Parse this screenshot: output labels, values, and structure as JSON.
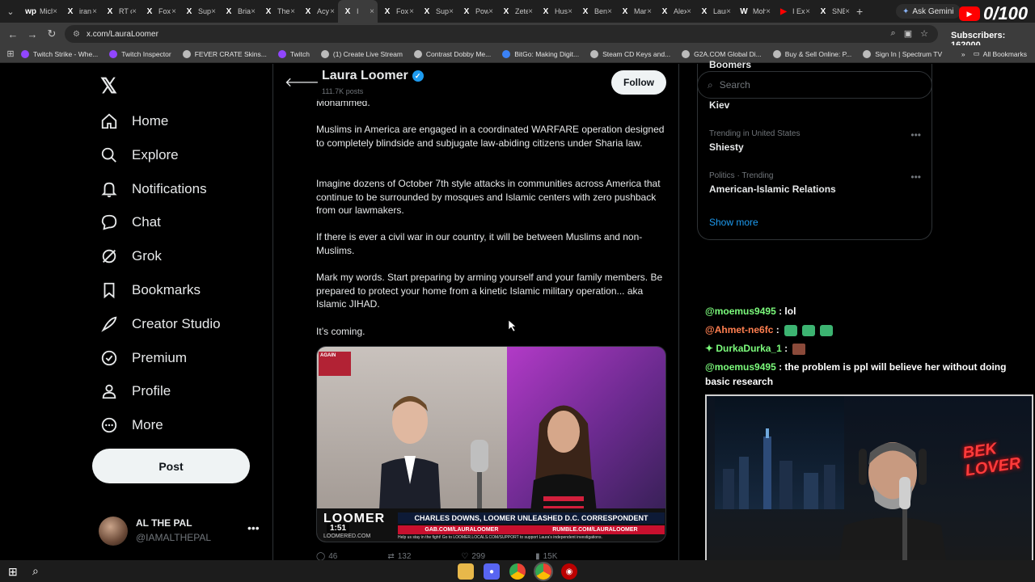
{
  "browser": {
    "tabs": [
      {
        "label": "Mich",
        "fav": "wp",
        "color": "#fff"
      },
      {
        "label": "iran",
        "fav": "X",
        "color": "#fff"
      },
      {
        "label": "RT o",
        "fav": "X",
        "color": "#fff"
      },
      {
        "label": "Fox",
        "fav": "X",
        "color": "#fff"
      },
      {
        "label": "Sup",
        "fav": "X",
        "color": "#fff"
      },
      {
        "label": "Bria",
        "fav": "X",
        "color": "#fff"
      },
      {
        "label": "The",
        "fav": "X",
        "color": "#fff"
      },
      {
        "label": "Acy",
        "fav": "X",
        "color": "#fff"
      },
      {
        "label": "I",
        "fav": "X",
        "color": "#fff"
      },
      {
        "label": "Fox",
        "fav": "X",
        "color": "#fff"
      },
      {
        "label": "Sup",
        "fav": "X",
        "color": "#fff"
      },
      {
        "label": "Pow",
        "fav": "X",
        "color": "#fff"
      },
      {
        "label": "Zete",
        "fav": "X",
        "color": "#fff"
      },
      {
        "label": "Hus",
        "fav": "X",
        "color": "#fff"
      },
      {
        "label": "Ben",
        "fav": "X",
        "color": "#fff"
      },
      {
        "label": "Mar",
        "fav": "X",
        "color": "#fff"
      },
      {
        "label": "Alex",
        "fav": "X",
        "color": "#fff"
      },
      {
        "label": "Laur",
        "fav": "X",
        "color": "#fff"
      },
      {
        "label": "Moh",
        "fav": "W",
        "color": "#fff"
      },
      {
        "label": "I Ex",
        "fav": "▶",
        "color": "#ff0000"
      },
      {
        "label": "SNE",
        "fav": "X",
        "color": "#fff"
      }
    ],
    "new_tab": "+",
    "ask_gemini": "Ask Gemini",
    "url": "x.com/LauraLoomer",
    "bookmarks": [
      "Twitch Strike - Whe...",
      "Twitch Inspector",
      "FEVER CRATE Skins...",
      "Twitch",
      "(1) Create Live Stream",
      "Contrast Dobby Me...",
      "BitGo: Making Digit...",
      "Steam CD Keys and...",
      "G2A.COM Global Di...",
      "Buy & Sell Online: P...",
      "Sign In | Spectrum TV"
    ],
    "all_bookmarks": "All Bookmarks"
  },
  "overlay": {
    "counter": "0/100",
    "subscribers": "Subscribers: 162000"
  },
  "nav": {
    "items": [
      {
        "label": "Home",
        "icon": "home-icon"
      },
      {
        "label": "Explore",
        "icon": "search-icon"
      },
      {
        "label": "Notifications",
        "icon": "bell-icon"
      },
      {
        "label": "Chat",
        "icon": "chat-icon"
      },
      {
        "label": "Grok",
        "icon": "grok-icon"
      },
      {
        "label": "Bookmarks",
        "icon": "bookmark-icon"
      },
      {
        "label": "Creator Studio",
        "icon": "rocket-icon"
      },
      {
        "label": "Premium",
        "icon": "verified-badge-icon"
      },
      {
        "label": "Profile",
        "icon": "person-icon"
      },
      {
        "label": "More",
        "icon": "more-circle-icon"
      }
    ],
    "post_label": "Post",
    "account_name": "AL THE PAL",
    "account_handle": "@IAMALTHEPAL"
  },
  "profile": {
    "name": "Laura Loomer",
    "posts": "111.7K posts",
    "follow": "Follow"
  },
  "tweet": {
    "paragraphs": [
      "Mohammed.",
      "Muslims in America are engaged in a coordinated WARFARE operation designed to completely blindside and subjugate law-abiding citizens under Sharia law.",
      "Imagine dozens of October 7th style attacks in communities across America that continue to be surrounded by mosques and Islamic centers with zero pushback from our lawmakers.",
      "If there is ever a civil war in our country, it will be between Muslims and non-Muslims.",
      "Mark my words. Start preparing by arming yourself and your family members. Be prepared to protect your home from a kinetic Islamic military operation... aka Islamic JIHAD.",
      "It’s coming."
    ],
    "video": {
      "brand": "LOOMER",
      "caption": "CHARLES DOWNS, LOOMER UNLEASHED D.C. CORRESPONDENT",
      "link1": "GAB.COM/LAURALOOMER",
      "link2": "RUMBLE.COM/LAURALOOMER",
      "ticker": "Help us stay in the fight! Go to LOOMER.LOCALS.COM/SUPPORT to support Laura's independent investigations.",
      "site": "LOOMERED.COM",
      "time": "1:51",
      "sign": "AGAIN"
    },
    "actions": {
      "replies": "46",
      "reposts": "132",
      "likes": "299",
      "views": "15K"
    }
  },
  "right": {
    "search_placeholder": "Search",
    "top_item": "Kiev",
    "top_clipped": "Boomers",
    "trends": [
      {
        "meta": "Trending in United States",
        "name": "Shiesty"
      },
      {
        "meta": "Politics · Trending",
        "name": "American-Islamic Relations"
      }
    ],
    "show_more": "Show more"
  },
  "chat": [
    {
      "user": "@moemus9495",
      "text": "lol"
    },
    {
      "user": "@Ahmet-ne6fc",
      "text": ""
    },
    {
      "user": "DurkaDurka_1",
      "text": ""
    },
    {
      "user": "@moemus9495",
      "text": "the problem is ppl will believe her without doing basic research"
    }
  ],
  "webcam": {
    "neon_line1": "BEK",
    "neon_line2": "LOVER"
  }
}
